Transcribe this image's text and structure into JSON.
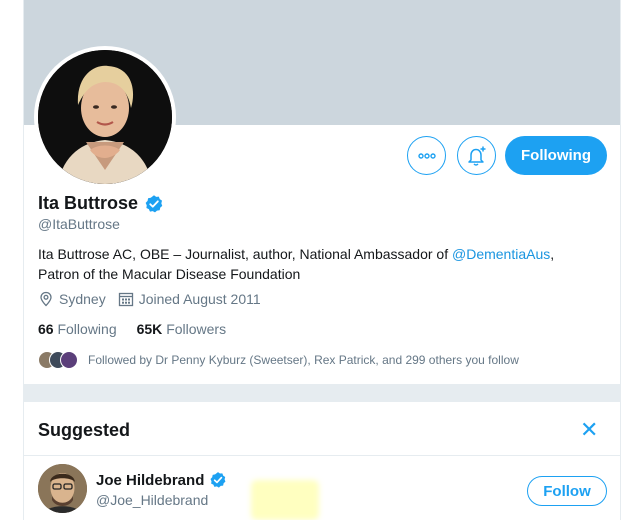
{
  "profile": {
    "name": "Ita Buttrose",
    "handle": "@ItaButtrose",
    "bio_prefix": "Ita Buttrose AC, OBE – Journalist, author, National Ambassador of ",
    "bio_link": "@DementiaAus",
    "bio_suffix": ",",
    "bio_line2": "Patron of the Macular Disease Foundation",
    "location": "Sydney",
    "joined": "Joined August 2011",
    "following_count": "66",
    "following_label": "Following",
    "followers_count": "65K",
    "followers_label": "Followers",
    "followed_by": "Followed by Dr Penny Kyburz (Sweetser), Rex Patrick, and 299 others you follow"
  },
  "actions": {
    "following_button": "Following",
    "more_icon": "more-dots-icon",
    "notify_icon": "bell-plus-icon"
  },
  "suggested": {
    "title": "Suggested",
    "close_label": "✕",
    "items": [
      {
        "name": "Joe Hildebrand",
        "handle": "@Joe_Hildebrand",
        "follow_label": "Follow"
      }
    ]
  },
  "colors": {
    "accent": "#1da1f2",
    "banner": "#ccd6dd",
    "muted_text": "#657786",
    "divider": "#e6ecf0"
  }
}
